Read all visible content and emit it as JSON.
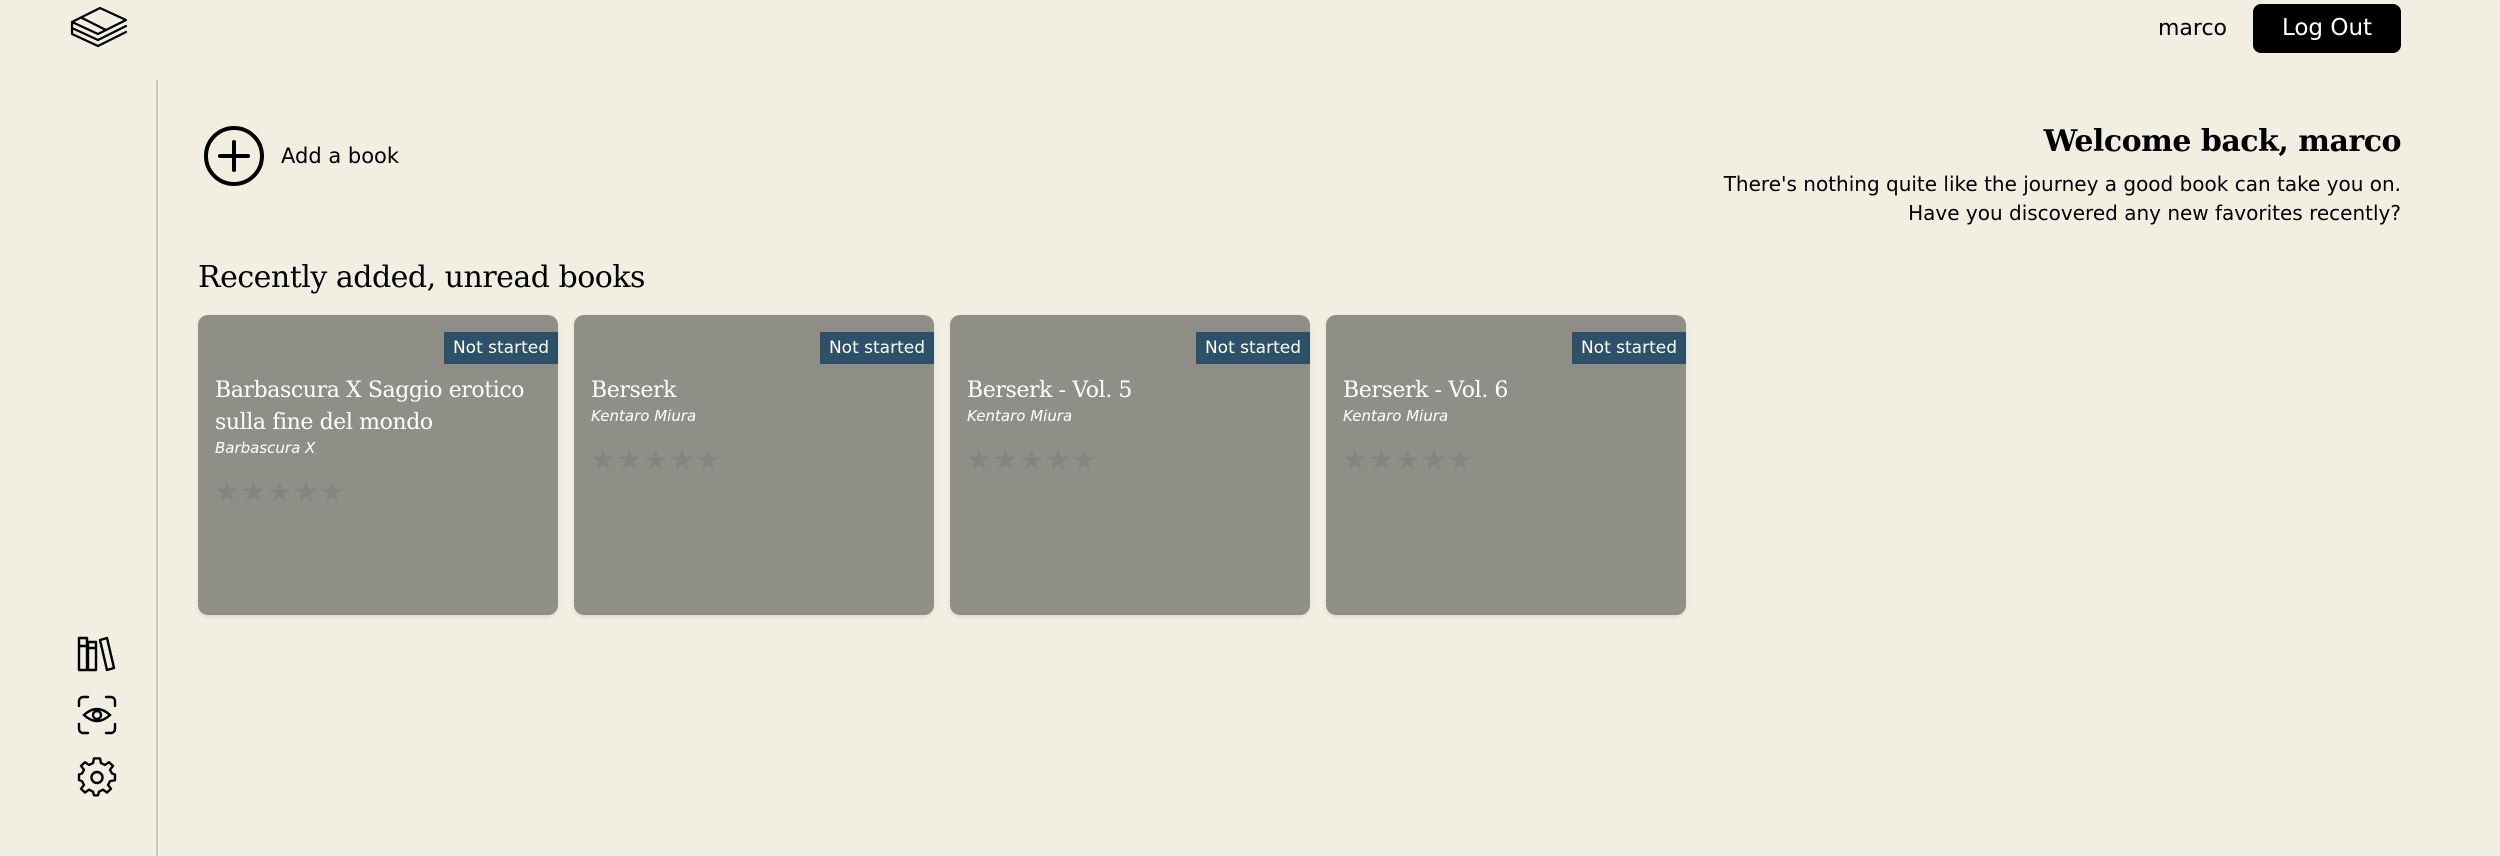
{
  "header": {
    "username": "marco",
    "logout_label": "Log Out"
  },
  "sidebar": {
    "icons": [
      "library-icon",
      "eye-scan-icon",
      "gear-icon"
    ]
  },
  "add_book": {
    "label": "Add a book"
  },
  "welcome": {
    "title": "Welcome back, marco",
    "text": "There's nothing quite like the journey a good book can take you on. Have you discovered any new favorites recently?"
  },
  "section": {
    "title": "Recently added, unread books"
  },
  "books": [
    {
      "status": "Not started",
      "title": "Barbascura X Saggio erotico sulla fine del mondo",
      "author": "Barbascura X",
      "rating": 0
    },
    {
      "status": "Not started",
      "title": "Berserk",
      "author": "Kentaro Miura",
      "rating": 0
    },
    {
      "status": "Not started",
      "title": "Berserk - Vol. 5",
      "author": "Kentaro Miura",
      "rating": 0
    },
    {
      "status": "Not started",
      "title": "Berserk - Vol. 6",
      "author": "Kentaro Miura",
      "rating": 0
    }
  ],
  "colors": {
    "background": "#f1eee2",
    "card": "#8f8f88",
    "badge": "#2e5068",
    "button": "#000000"
  }
}
